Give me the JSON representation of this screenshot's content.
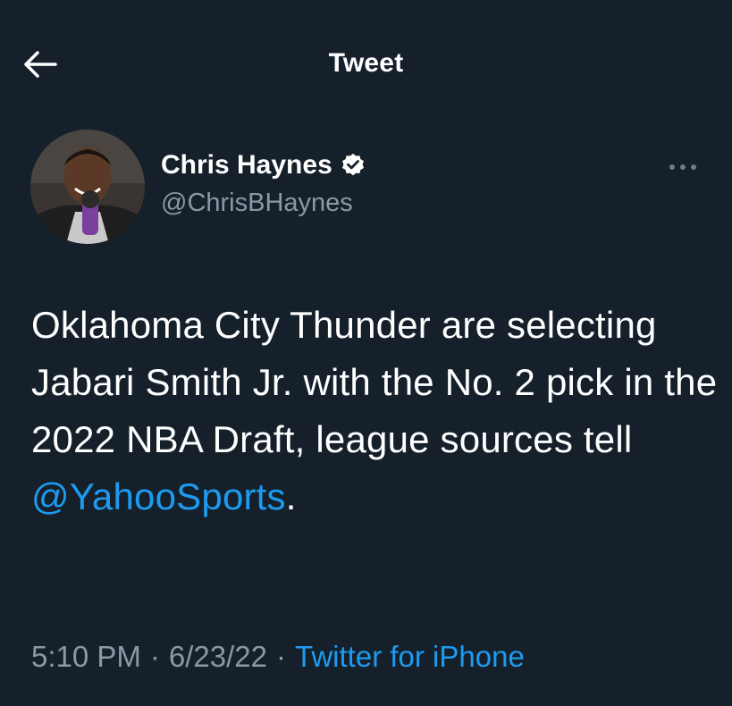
{
  "header": {
    "title": "Tweet",
    "back_icon": "arrow-left-icon"
  },
  "author": {
    "display_name": "Chris Haynes",
    "handle": "@ChrisBHaynes",
    "verified": true,
    "verified_icon": "verified-badge-icon",
    "more_icon": "more-horizontal-icon"
  },
  "tweet": {
    "text_before": "Oklahoma City Thunder are selecting Jabari Smith Jr. with the No. 2 pick in the 2022 NBA Draft, league sources tell ",
    "mention": "@YahooSports",
    "text_after": "."
  },
  "meta": {
    "time": "5:10 PM",
    "separator": "·",
    "date": "6/23/22",
    "source": "Twitter for iPhone"
  },
  "colors": {
    "background": "#15202b",
    "accent": "#1d9bf0",
    "secondary_text": "#8b98a5"
  }
}
